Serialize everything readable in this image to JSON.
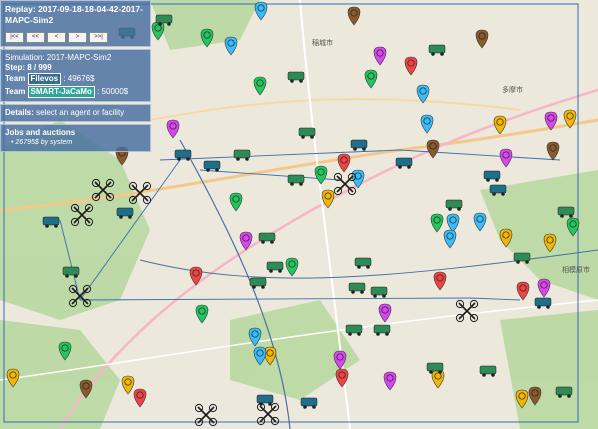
{
  "replay": {
    "title": "Replay: 2017-09-18-18-04-42-2017-MAPC-Sim2",
    "buttons": [
      "|<<",
      "<<",
      "<",
      ">",
      ">>|"
    ]
  },
  "simulation": {
    "name": "Simulation: 2017-MAPC-Sim2",
    "step": "Step: 8 / 999",
    "team1_prefix": "Team ",
    "team1_name": "Filevos",
    "team1_money": " : 49676$",
    "team2_prefix": "Team ",
    "team2_name": "SMART-JaCaMo",
    "team2_money": " : 50000$"
  },
  "details": {
    "label": "Details:",
    "value": " select an agent or facility"
  },
  "jobs": {
    "title": "Jobs and auctions",
    "items": [
      "26795$ by system"
    ]
  },
  "map_labels": [
    "稲城市",
    "多摩市",
    "相模原市"
  ],
  "colors": {
    "panel": "#466ea0",
    "team1_vehicle": "#1f6f8b",
    "team2_vehicle": "#2e8b57",
    "facility_shop": "#d946ef",
    "facility_workshop": "#22c55e",
    "facility_storage": "#8b5a2b",
    "facility_charging": "#f2b705",
    "facility_dump": "#ef4444",
    "facility_resource": "#38bdf8"
  }
}
